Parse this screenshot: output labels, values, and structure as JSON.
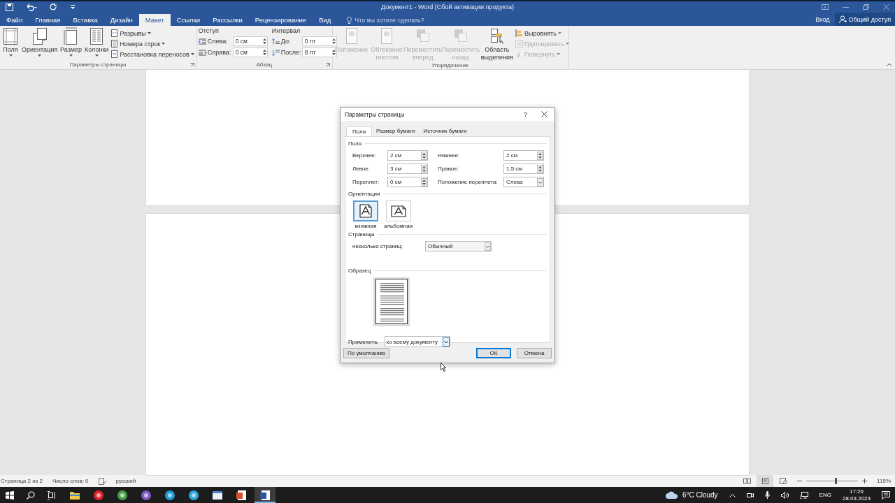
{
  "window": {
    "title": "Документ1 - Word (Сбой активации продукта)"
  },
  "tabs": [
    {
      "label": "Файл",
      "selected": false
    },
    {
      "label": "Главная",
      "selected": false
    },
    {
      "label": "Вставка",
      "selected": false
    },
    {
      "label": "Дизайн",
      "selected": false
    },
    {
      "label": "Макет",
      "selected": true
    },
    {
      "label": "Ссылки",
      "selected": false
    },
    {
      "label": "Рассылки",
      "selected": false
    },
    {
      "label": "Рецензирование",
      "selected": false
    },
    {
      "label": "Вид",
      "selected": false
    }
  ],
  "tell_me": {
    "placeholder": "Что вы хотите сделать?"
  },
  "account": {
    "sign_in": "Вход",
    "share": "Общий доступ"
  },
  "ribbon": {
    "page_setup": {
      "label": "Параметры страницы",
      "big_buttons": [
        {
          "kind": "margins",
          "label": "Поля"
        },
        {
          "kind": "orientation",
          "label": "Ориентация"
        },
        {
          "kind": "size",
          "label": "Размер"
        },
        {
          "kind": "columns",
          "label": "Колонки"
        }
      ],
      "small_buttons": [
        {
          "kind": "breaks",
          "label": "Разрывы"
        },
        {
          "kind": "line_numbers",
          "label": "Номера строк"
        },
        {
          "kind": "hyphenation",
          "label": "Расстановка переносов"
        }
      ]
    },
    "paragraph": {
      "label": "Абзац",
      "indent": {
        "heading": "Отступ",
        "fields": [
          {
            "kind": "left",
            "label": "Слева:",
            "value": "0 см"
          },
          {
            "kind": "right",
            "label": "Справа:",
            "value": "0 см"
          }
        ]
      },
      "spacing": {
        "heading": "Интервал",
        "fields": [
          {
            "kind": "before",
            "label": "До:",
            "value": "0 пт"
          },
          {
            "kind": "after",
            "label": "После:",
            "value": "8 пт"
          }
        ]
      }
    },
    "arrange": {
      "label": "Упорядочение",
      "big_buttons": [
        {
          "kind": "position",
          "label": "Положение",
          "disabled": true
        },
        {
          "kind": "wrap",
          "label": "Обтекание текстом",
          "disabled": true
        },
        {
          "kind": "forward",
          "label": "Переместить вперед",
          "disabled": true
        },
        {
          "kind": "backward",
          "label": "Переместить назад",
          "disabled": true
        },
        {
          "kind": "selection",
          "label": "Область выделения",
          "disabled": false
        }
      ],
      "small_buttons": [
        {
          "kind": "align",
          "label": "Выровнять",
          "disabled": false
        },
        {
          "kind": "group",
          "label": "Группировать",
          "disabled": true
        },
        {
          "kind": "rotate",
          "label": "Повернуть",
          "disabled": true
        }
      ]
    }
  },
  "dialog": {
    "title": "Параметры страницы",
    "help": "?",
    "tabs": [
      {
        "label": "Поля",
        "selected": true
      },
      {
        "label": "Размер бумаги",
        "selected": false
      },
      {
        "label": "Источник бумаги",
        "selected": false
      }
    ],
    "margins": {
      "heading": "Поля",
      "fields": [
        {
          "label": "Верхнее:",
          "value": "2 см",
          "kind": "spin"
        },
        {
          "label": "Нижнее:",
          "value": "2 см",
          "kind": "spin"
        },
        {
          "label": "Левое:",
          "value": "3 см",
          "kind": "spin"
        },
        {
          "label": "Правое:",
          "value": "1,5 см",
          "kind": "spin"
        },
        {
          "label": "Переплет:",
          "value": "0 см",
          "kind": "spin"
        },
        {
          "label": "Положение переплета:",
          "value": "Слева",
          "kind": "select"
        }
      ]
    },
    "orientation": {
      "heading": "Ориентация",
      "options": [
        {
          "kind": "portrait",
          "label": "книжная",
          "selected": true
        },
        {
          "kind": "landscape",
          "label": "альбомная",
          "selected": false
        }
      ]
    },
    "pages": {
      "heading": "Страницы",
      "label": "несколько страниц:",
      "value": "Обычный"
    },
    "preview": {
      "heading": "Образец"
    },
    "apply": {
      "label": "Применить:",
      "value": "ко всему документу"
    },
    "buttons": {
      "default": "По умолчанию",
      "ok": "ОК",
      "cancel": "Отмена"
    }
  },
  "status_bar": {
    "page": "Страница 2 из 2",
    "words": "Число слов: 0",
    "language": "русский",
    "views": [
      {
        "kind": "read",
        "selected": false
      },
      {
        "kind": "print",
        "selected": true
      },
      {
        "kind": "web",
        "selected": false
      }
    ],
    "zoom": {
      "level": 0.55
    },
    "zoom_text": "115%"
  },
  "taskbar": {
    "apps": [
      {
        "kind": "folder",
        "active": false
      },
      {
        "kind": "opera",
        "active": false
      },
      {
        "kind": "chrome",
        "active": false
      },
      {
        "kind": "viber",
        "active": false
      },
      {
        "kind": "edge",
        "active": false
      },
      {
        "kind": "telegram",
        "active": false
      },
      {
        "kind": "window",
        "active": false
      },
      {
        "kind": "slides",
        "active": false
      },
      {
        "kind": "word",
        "active": true
      }
    ],
    "weather": "6°C  Cloudy",
    "language": "ENG",
    "time": "17:26",
    "date": "28.03.2023"
  }
}
